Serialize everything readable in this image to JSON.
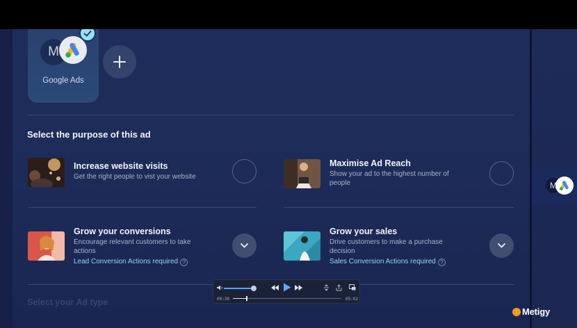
{
  "platform": {
    "name": "Google Ads",
    "logo_letter": "M",
    "selected": true
  },
  "purpose_section": {
    "title": "Select the purpose of this ad",
    "options": [
      {
        "title": "Increase website visits",
        "description": "Get the right people to vist your website",
        "requirement": ""
      },
      {
        "title": "Maximise Ad Reach",
        "description": "Show your ad to the highest number of people",
        "requirement": ""
      },
      {
        "title": "Grow your conversions",
        "description": "Encourage relevant customers to take actions",
        "requirement": "Lead Conversion Actions required"
      },
      {
        "title": "Grow your sales",
        "description": "Drive customers to make a purchase decision",
        "requirement": "Sales Conversion Actions required"
      }
    ]
  },
  "ad_type_section": {
    "title": "Select your Ad type"
  },
  "player": {
    "current_time": "00:39",
    "duration": "05:02",
    "progress": 0.13,
    "volume": 0.95
  },
  "side_panel": {
    "logo_letter": "M"
  },
  "brand": {
    "name": "Metigy"
  },
  "colors": {
    "background": "#1d2b58",
    "accent_link": "#8fd7ef",
    "check_badge": "#8ee3f0",
    "brand_dot": "#f39a1f"
  },
  "icons": [
    "check-icon",
    "plus-icon",
    "chevron-down-icon",
    "help-icon",
    "volume-icon",
    "rewind-icon",
    "play-icon",
    "fast-forward-icon",
    "speed-icon",
    "share-icon",
    "picture-in-picture-icon",
    "google-ads-logo"
  ]
}
